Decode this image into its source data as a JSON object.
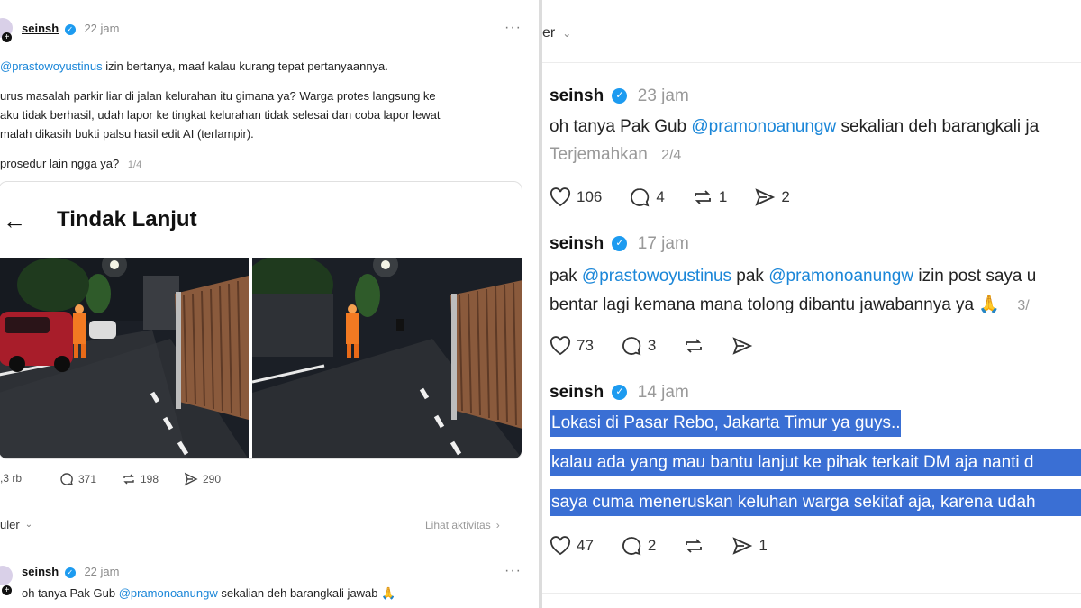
{
  "left": {
    "post1": {
      "username": "seinsh",
      "time": "22 jam",
      "mention": "@prastowoyustinus",
      "line1_rest": " izin bertanya, maaf kalau kurang tepat pertanyaannya.",
      "line2": "urus masalah parkir liar di jalan kelurahan itu gimana ya? Warga protes langsung ke",
      "line3": "aku tidak berhasil, udah lapor ke tingkat kelurahan tidak selesai dan coba lapor lewat",
      "line4": " malah dikasih bukti palsu hasil edit AI (terlampir).",
      "line5": " prosedur lain ngga ya?",
      "counter": "1/4",
      "card_title": "Tindak Lanjut",
      "likes": ",3 rb",
      "comments": "371",
      "reposts": "198",
      "shares": "290"
    },
    "populer_label": "uler",
    "activity_link": "Lihat aktivitas",
    "post2": {
      "username": "seinsh",
      "time": "22 jam",
      "text_before": "oh tanya Pak Gub ",
      "mention": "@pramonoanungw",
      "text_after": " sekalian deh barangkali jawab 🙏"
    }
  },
  "right": {
    "top_label": "er",
    "post1": {
      "username": "seinsh",
      "time": "23 jam",
      "text_before": "oh tanya Pak Gub ",
      "mention": "@pramonoanungw",
      "text_after": " sekalian deh barangkali ja",
      "translate": "Terjemahkan",
      "counter": "2/4",
      "likes": "106",
      "comments": "4",
      "reposts": "1",
      "shares": "2"
    },
    "post2": {
      "username": "seinsh",
      "time": "17 jam",
      "l1_pre": "pak ",
      "l1_mention1": "@prastowoyustinus",
      "l1_mid": " pak ",
      "l1_mention2": "@pramonoanungw",
      "l1_post": " izin post saya u",
      "l2": "bentar lagi kemana mana tolong dibantu jawabannya ya 🙏",
      "counter": "3/",
      "likes": "73",
      "comments": "3"
    },
    "post3": {
      "username": "seinsh",
      "time": "14 jam",
      "hl1": "Lokasi di Pasar Rebo, Jakarta Timur ya guys..",
      "hl2": "kalau ada yang mau bantu lanjut ke pihak terkait DM aja nanti d",
      "hl3": "saya cuma meneruskan keluhan warga sekitaf aja, karena udah",
      "likes": "47",
      "comments": "2",
      "shares": "1"
    }
  },
  "colors": {
    "mention": "#1a86d8",
    "verified": "#1d9bf0",
    "highlight": "#3a6fd4"
  }
}
